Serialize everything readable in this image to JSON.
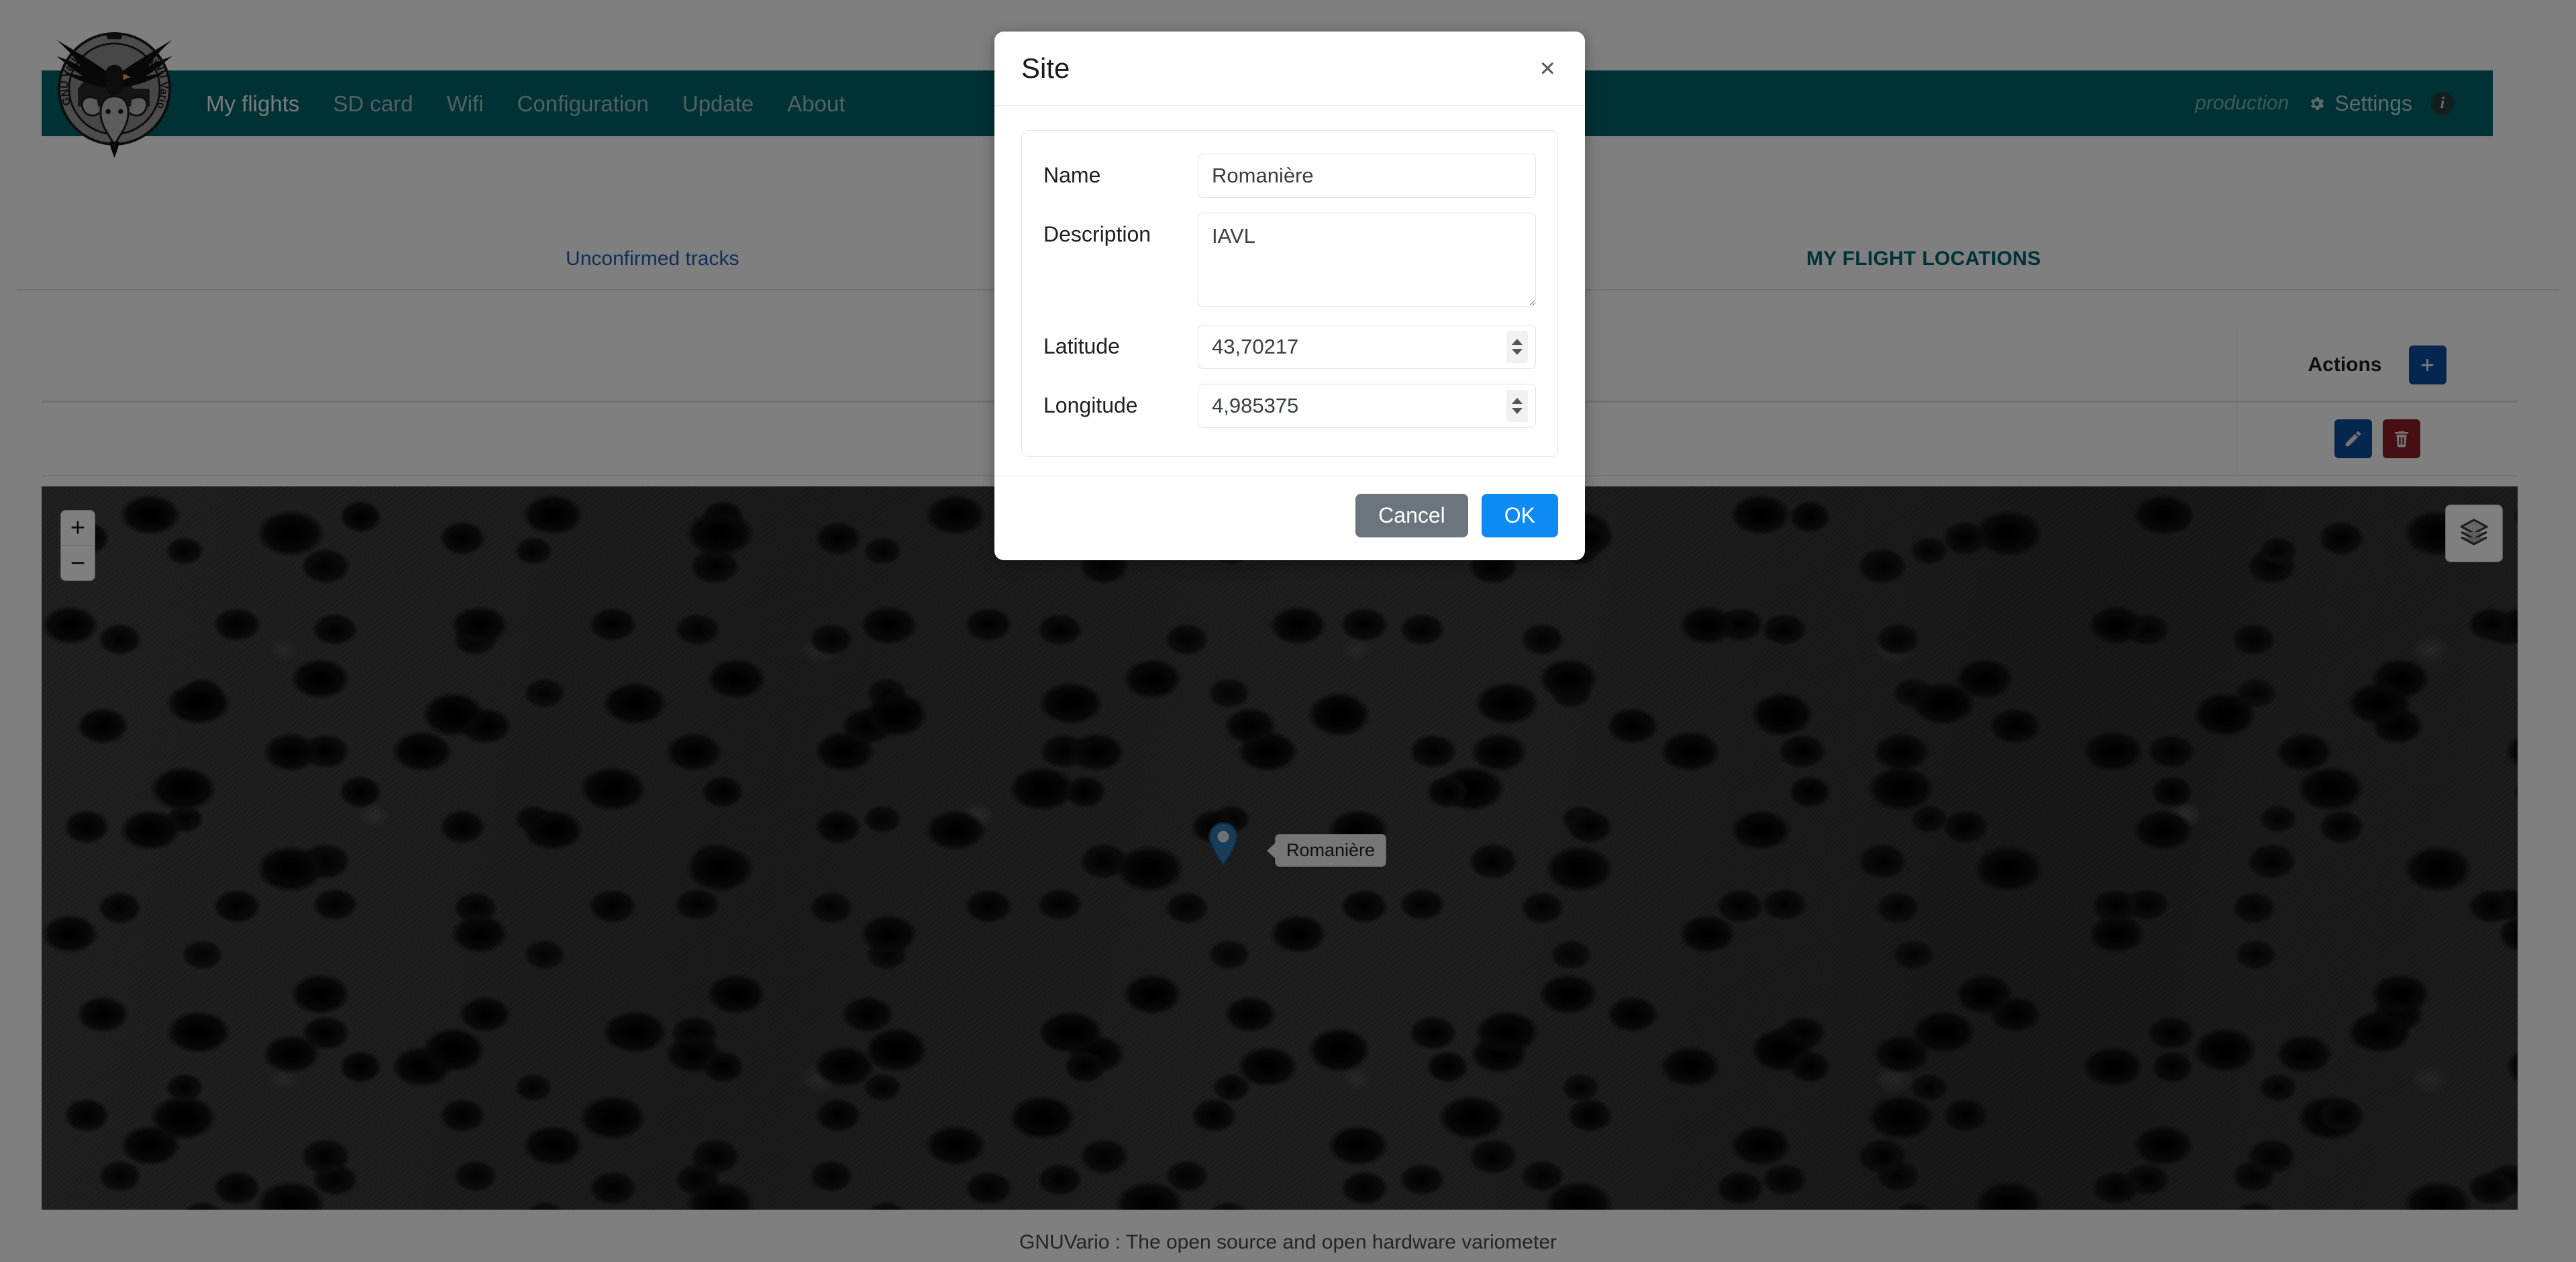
{
  "app": {
    "logo_alt": "GNU Vario",
    "logo_text": "GNU Vario",
    "footer": "GNUVario : The open source and open hardware variometer"
  },
  "navbar": {
    "links": [
      {
        "label": "My flights",
        "active": true
      },
      {
        "label": "SD card",
        "active": false
      },
      {
        "label": "Wifi",
        "active": false
      },
      {
        "label": "Configuration",
        "active": false
      },
      {
        "label": "Update",
        "active": false
      },
      {
        "label": "About",
        "active": false
      }
    ],
    "environment": "production",
    "settings_label": "Settings",
    "info_label": "i"
  },
  "tabs": [
    {
      "label": "Unconfirmed tracks",
      "active": false
    },
    {
      "label": "MY FLIGHT LOCATIONS",
      "active": true
    }
  ],
  "table": {
    "actions_header": "Actions",
    "add_label": "+",
    "rows": [
      {
        "edit_label": "edit",
        "delete_label": "delete"
      }
    ]
  },
  "map": {
    "zoom_in": "+",
    "zoom_out": "−",
    "layers_label": "Layers",
    "marker_label": "Romanière"
  },
  "modal": {
    "title": "Site",
    "close_label": "×",
    "fields": {
      "name": {
        "label": "Name",
        "value": "Romanière"
      },
      "description": {
        "label": "Description",
        "value": "IAVL"
      },
      "latitude": {
        "label": "Latitude",
        "value": "43,70217"
      },
      "longitude": {
        "label": "Longitude",
        "value": "4,985375"
      }
    },
    "cancel_label": "Cancel",
    "ok_label": "OK"
  },
  "colors": {
    "navbar": "#00636b",
    "tab_active": "#00656d",
    "tab_inactive": "#1f5fb0",
    "primary": "#0a4f9e",
    "danger": "#8c1f26",
    "ok": "#0d8bf2",
    "cancel": "#6c757d",
    "marker": "#2e7bb5"
  }
}
